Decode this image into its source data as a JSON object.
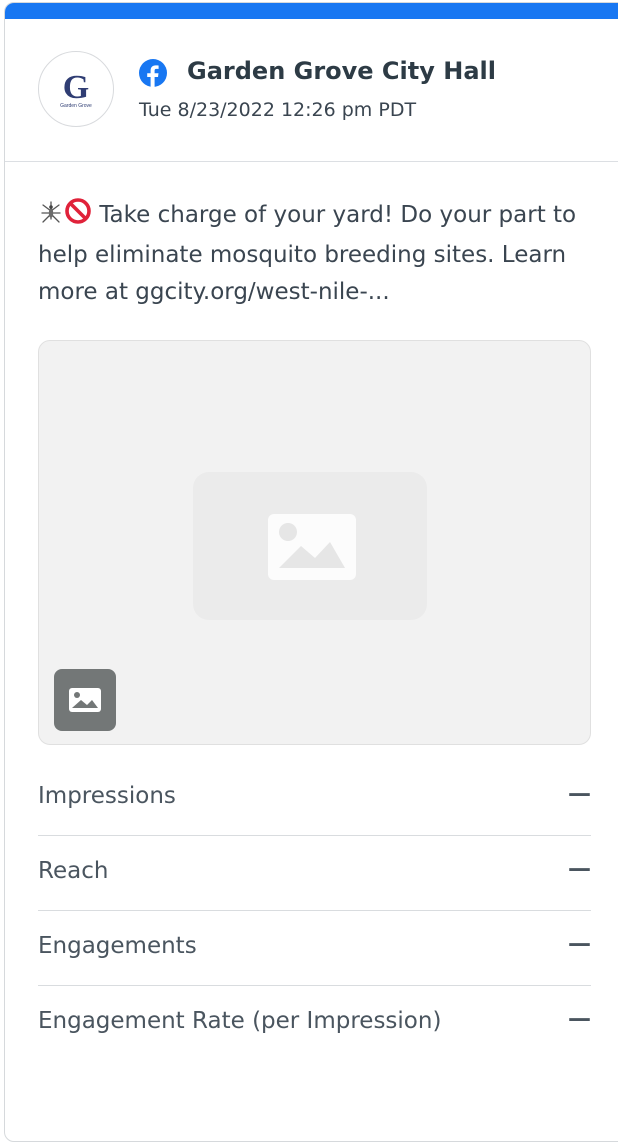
{
  "header": {
    "account_name": "Garden Grove City Hall",
    "timestamp": "Tue 8/23/2022 12:26 pm PDT",
    "network": "facebook-icon",
    "avatar": {
      "logo_letter": "G",
      "logo_caption": "Garden Grove"
    }
  },
  "post": {
    "emojis": [
      "mosquito-emoji",
      "prohibited-emoji"
    ],
    "message": "Take charge of your yard! Do your part to help eliminate mosquito breeding sites. Learn more at ggcity.org/west-nile-..."
  },
  "media": {
    "placeholder_icon": "image-icon",
    "type_badge_icon": "image-icon"
  },
  "metrics": [
    {
      "label": "Impressions",
      "value": "—"
    },
    {
      "label": "Reach",
      "value": "—"
    },
    {
      "label": "Engagements",
      "value": "—"
    },
    {
      "label": "Engagement Rate (per Impression)",
      "value": "—"
    }
  ],
  "colors": {
    "facebook_blue": "#1877f2",
    "text_dark": "#2d3b45",
    "text_muted": "#4a555f",
    "media_bg": "#f2f2f2",
    "badge_bg": "#737777",
    "prohibited_red": "#e0223a"
  }
}
